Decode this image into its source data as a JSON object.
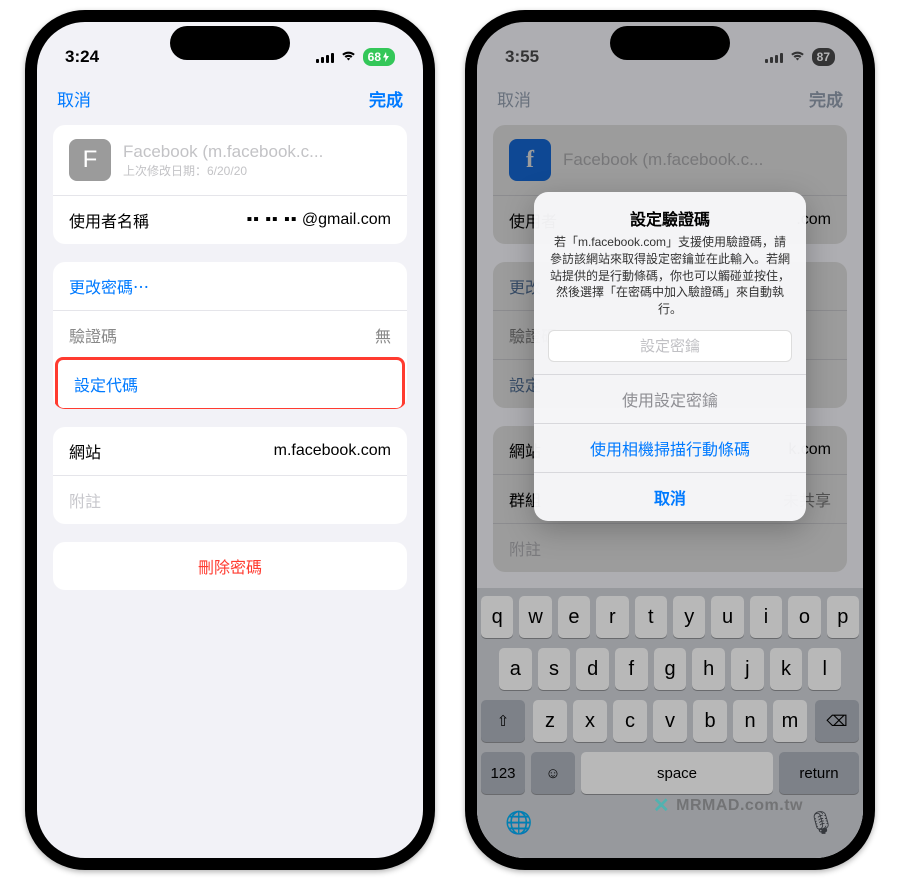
{
  "left": {
    "status": {
      "time": "3:24",
      "battery": "68"
    },
    "nav": {
      "cancel": "取消",
      "done": "完成"
    },
    "header": {
      "icon_letter": "F",
      "title": "Facebook (m.facebook.c...",
      "subtitle": "上次修改日期：6/20/20"
    },
    "rows": {
      "username_label": "使用者名稱",
      "username_value": "@gmail.com",
      "username_mask": "▪▪  ▪▪ ▪▪",
      "change_password": "更改密碼⋯",
      "verify_label": "驗證碼",
      "verify_value": "無",
      "setup_code": "設定代碼",
      "website_label": "網站",
      "website_value": "m.facebook.com",
      "notes_placeholder": "附註",
      "delete": "刪除密碼"
    }
  },
  "right": {
    "status": {
      "time": "3:55",
      "battery": "87"
    },
    "nav": {
      "cancel": "取消",
      "done": "完成"
    },
    "header": {
      "icon_letter": "f",
      "title": "Facebook (m.facebook.c..."
    },
    "rows": {
      "username_label": "使用者",
      "username_suffix": ".com",
      "change_password": "更改",
      "verify_label": "驗證碼",
      "setup_code": "設定",
      "website_label": "網站",
      "website_suffix": "k.com",
      "group_label": "群組",
      "group_value": "未共享",
      "notes_placeholder": "附註"
    },
    "sheet": {
      "title": "設定驗證碼",
      "message": "若「m.facebook.com」支援使用驗證碼，請參訪該網站來取得設定密鑰並在此輸入。若網站提供的是行動條碼，你也可以觸碰並按住，然後選擇「在密碼中加入驗證碼」來自動執行。",
      "input_placeholder": "設定密鑰",
      "use_key": "使用設定密鑰",
      "scan": "使用相機掃描行動條碼",
      "cancel": "取消"
    },
    "keyboard": {
      "row1": [
        "q",
        "w",
        "e",
        "r",
        "t",
        "y",
        "u",
        "i",
        "o",
        "p"
      ],
      "row2": [
        "a",
        "s",
        "d",
        "f",
        "g",
        "h",
        "j",
        "k",
        "l"
      ],
      "row3": [
        "z",
        "x",
        "c",
        "v",
        "b",
        "n",
        "m"
      ],
      "shift": "⇧",
      "backspace": "⌫",
      "numbers": "123",
      "emoji": "☺",
      "space": "space",
      "return": "return",
      "globe": "🌐",
      "mic": "🎙"
    }
  },
  "watermark": {
    "brand": "MRMAD",
    "suffix": ".com.tw"
  }
}
